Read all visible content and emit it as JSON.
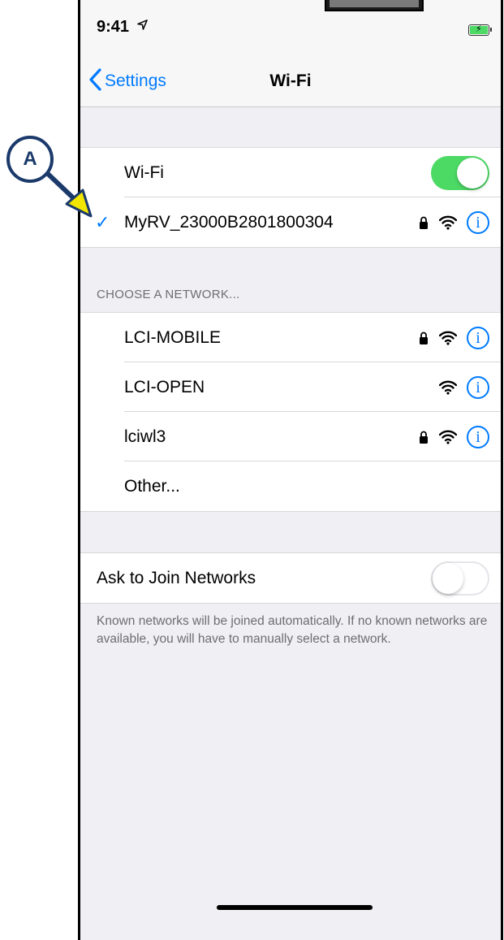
{
  "status": {
    "time": "9:41",
    "location_icon": "location-arrow-icon",
    "battery_icon": "battery-charging-icon"
  },
  "nav": {
    "back_label": "Settings",
    "title": "Wi-Fi"
  },
  "wifi_toggle": {
    "label": "Wi-Fi",
    "on": true
  },
  "connected": {
    "name": "MyRV_23000B2801800304",
    "secured": true
  },
  "networks_header": "CHOOSE A NETWORK...",
  "networks": [
    {
      "name": "LCI-MOBILE",
      "secured": true
    },
    {
      "name": "LCI-OPEN",
      "secured": false
    },
    {
      "name": "lciwl3",
      "secured": true
    }
  ],
  "other_label": "Other...",
  "ask_join": {
    "label": "Ask to Join Networks",
    "on": false
  },
  "ask_join_note": "Known networks will be joined automatically. If no known networks are available, you will have to manually select a network.",
  "annotation": {
    "label": "A"
  },
  "colors": {
    "accent": "#007aff",
    "toggle_on": "#4cd964",
    "annotation": "#1b3a6b",
    "annotation_arrowhead": "#f2e600"
  }
}
